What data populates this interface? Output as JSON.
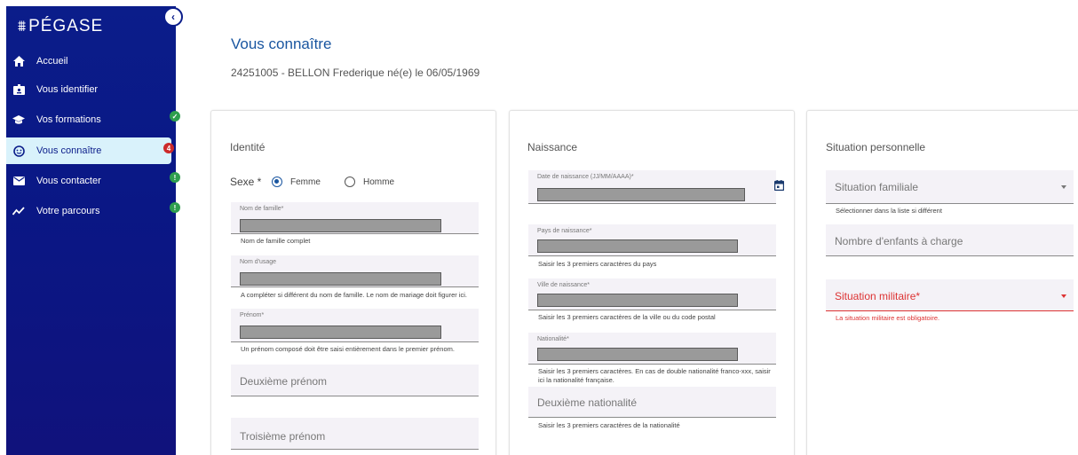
{
  "sidebar": {
    "logo": "PÉGASE",
    "items": [
      {
        "label": "Accueil",
        "icon": "home-icon"
      },
      {
        "label": "Vous identifier",
        "icon": "id-card-icon"
      },
      {
        "label": "Vos formations",
        "icon": "graduation-cap-icon",
        "badge": "✓",
        "badge_color": "#2e9e4e"
      },
      {
        "label": "Vous connaître",
        "icon": "face-icon",
        "badge": "4",
        "badge_color": "#cc2a2a",
        "active": true
      },
      {
        "label": "Vous contacter",
        "icon": "mail-icon",
        "badge": "!",
        "badge_color": "#2e9e4e"
      },
      {
        "label": "Votre parcours",
        "icon": "trend-icon",
        "badge": "!",
        "badge_color": "#2e9e4e"
      }
    ]
  },
  "header": {
    "title": "Vous connaître",
    "student": "24251005 - BELLON Frederique né(e) le 06/05/1969"
  },
  "identite": {
    "title": "Identité",
    "sexe_label": "Sexe *",
    "femme": "Femme",
    "homme": "Homme",
    "nom_famille_label": "Nom de famille*",
    "nom_famille_hint": "Nom de famille complet",
    "nom_usage_label": "Nom d'usage",
    "nom_usage_hint": "A compléter si différent du nom de famille. Le nom de mariage doit figurer ici.",
    "prenom_label": "Prénom*",
    "prenom_hint": "Un prénom composé doit être saisi entièrement dans le premier prénom.",
    "deuxieme_prenom": "Deuxième prénom",
    "troisieme_prenom": "Troisième prénom"
  },
  "naissance": {
    "title": "Naissance",
    "date_label": "Date de naissance (JJ/MM/AAAA)*",
    "pays_label": "Pays de naissance*",
    "pays_hint": "Saisir les 3 premiers caractères du pays",
    "ville_label": "Ville de naissance*",
    "ville_hint": "Saisir les 3 premiers caractères de la ville ou du code postal",
    "nationalite_label": "Nationalité*",
    "nationalite_hint": "Saisir les 3 premiers caractères. En cas de double nationalité franco-xxx, saisir ici la nationalité française.",
    "deuxieme_nationalite": "Deuxième nationalité",
    "deuxieme_nationalite_hint": "Saisir les 3 premiers caractères de la nationalité"
  },
  "situation": {
    "title": "Situation personnelle",
    "familiale": "Situation familiale",
    "familiale_hint": "Sélectionner dans la liste si différent",
    "enfants": "Nombre d'enfants à charge",
    "militaire": "Situation militaire*",
    "militaire_error": "La situation militaire est obligatoire."
  },
  "colors": {
    "sidebar": "#0b1d8a",
    "accent": "#1a56a0",
    "error": "#d33333",
    "active_bg": "#d9f2fb"
  }
}
